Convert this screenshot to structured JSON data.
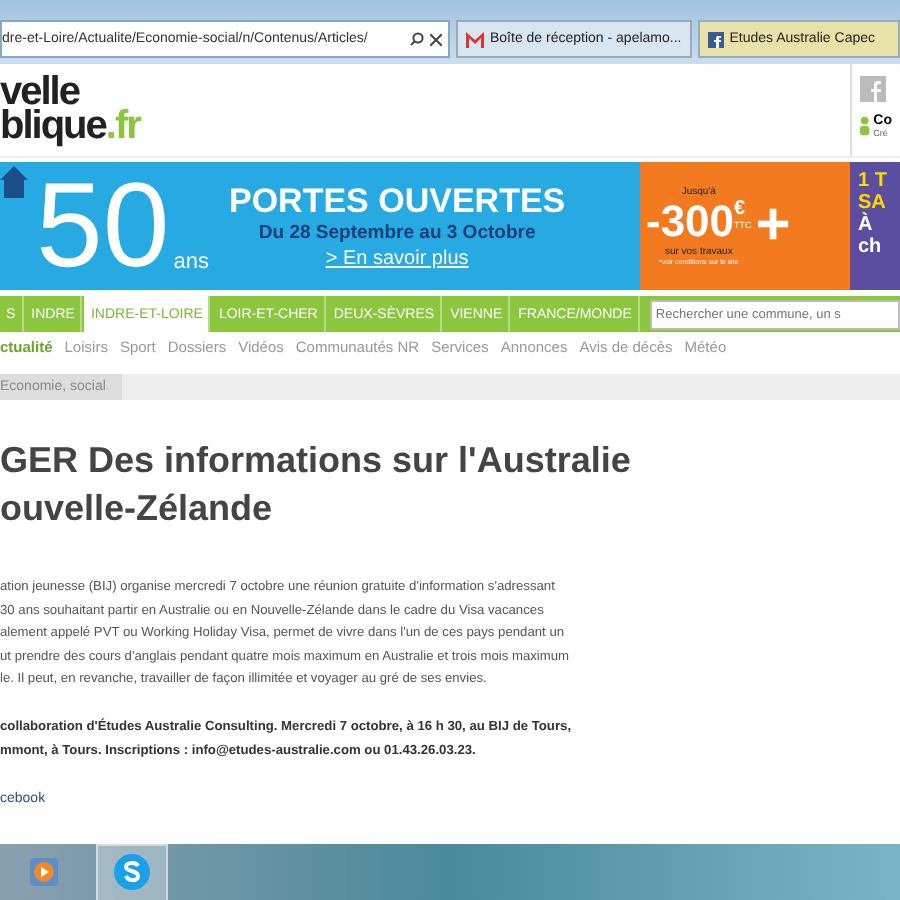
{
  "browser": {
    "address": "dre-et-Loire/Actualite/Economie-social/n/Contenus/Articles/",
    "tabs": [
      {
        "title": "Boîte de réception - apelamo...",
        "kind": "mail",
        "selected": false
      },
      {
        "title": "Etudes Australie Capec",
        "kind": "facebook",
        "selected": true
      }
    ]
  },
  "header": {
    "logo_top": "velle",
    "logo_bottom": "blique",
    "logo_suffix": ".fr",
    "account_label": "Co",
    "account_sub": "Cré"
  },
  "banner": {
    "big_number": "50",
    "ans": "ans",
    "headline": "PORTES OUVERTES",
    "dates": "Du 28 Septembre au 3 Octobre",
    "link": "> En savoir plus",
    "offer_top": "Jusqu'à",
    "offer_amount": "-300",
    "offer_currency": "€",
    "offer_ttc": "TTC",
    "offer_sub": "sur vos travaux",
    "offer_note": "*voir conditions sur le site",
    "plus": "+",
    "promo_lines": [
      "1 T",
      "SA",
      "À",
      "ch"
    ]
  },
  "nav": {
    "items": [
      {
        "label": "S",
        "selected": false
      },
      {
        "label": "INDRE",
        "selected": false
      },
      {
        "label": "INDRE-ET-LOIRE",
        "selected": true
      },
      {
        "label": "LOIR-ET-CHER",
        "selected": false
      },
      {
        "label": "DEUX-SÈVRES",
        "selected": false
      },
      {
        "label": "VIENNE",
        "selected": false
      },
      {
        "label": "FRANCE/MONDE",
        "selected": false
      }
    ],
    "search_placeholder": "Rechercher une commune, un s"
  },
  "subnav": [
    {
      "label": "ctualité",
      "selected": true
    },
    {
      "label": "Loisirs",
      "selected": false
    },
    {
      "label": "Sport",
      "selected": false
    },
    {
      "label": "Dossiers",
      "selected": false
    },
    {
      "label": "Vidéos",
      "selected": false
    },
    {
      "label": "Communautés NR",
      "selected": false
    },
    {
      "label": "Services",
      "selected": false
    },
    {
      "label": "Annonces",
      "selected": false
    },
    {
      "label": "Avis de décès",
      "selected": false
    },
    {
      "label": "Météo",
      "selected": false
    }
  ],
  "breadcrumb": "Economie, social",
  "article": {
    "title_lines": [
      "GER Des informations sur l'Australie",
      "ouvelle-Zélande"
    ],
    "body_lines": [
      "ation jeunesse (BIJ) organise mercredi 7 octobre une réunion gratuite d'information s'adressant",
      "30 ans souhaitant partir en Australie ou en Nouvelle-Zélande dans le cadre du Visa vacances",
      "alement appelé PVT ou Working Holiday Visa, permet de vivre dans l'un de ces pays pendant un",
      "ut prendre des cours d'anglais pendant quatre mois maximum en Australie et trois mois maximum",
      "le. Il peut, en revanche, travailler de façon illimitée et voyager au gré de ses envies."
    ],
    "info_lines": [
      "collaboration d'Études Australie Consulting. Mercredi 7 octobre, à 16 h 30, au BIJ de Tours,",
      "mmont, à Tours. Inscriptions : info@etudes-australie.com ou 01.43.26.03.23."
    ],
    "link": "cebook"
  },
  "taskbar": [
    {
      "kind": "media",
      "selected": false
    },
    {
      "kind": "skype",
      "selected": true
    }
  ]
}
